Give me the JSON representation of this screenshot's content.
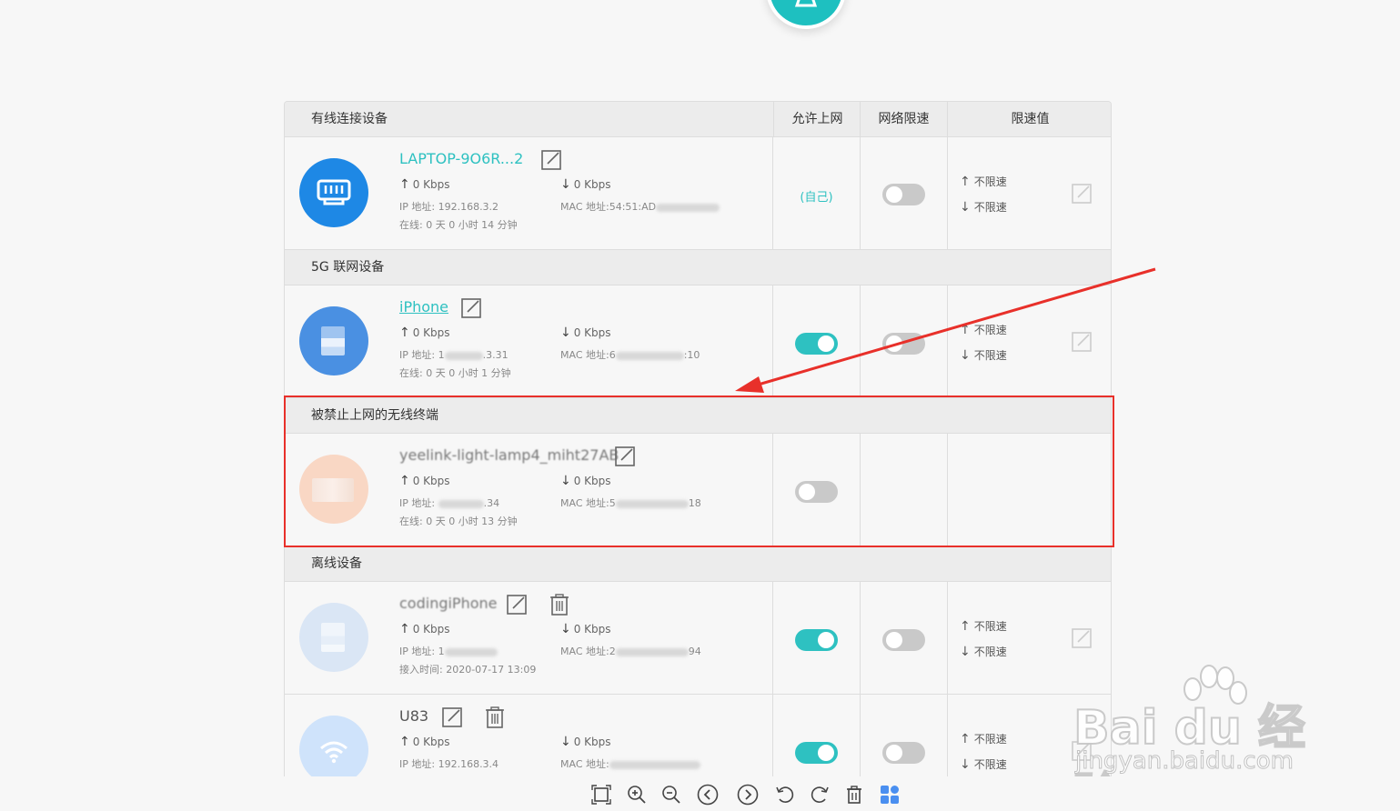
{
  "header": {
    "col_device": "有线连接设备",
    "col_allow": "允许上网",
    "col_speed_limit": "网络限速",
    "col_limit_value": "限速值"
  },
  "sections": {
    "wired": "有线连接设备",
    "g5": "5G 联网设备",
    "blocked": "被禁止上网的无线终端",
    "offline": "离线设备"
  },
  "devices": [
    {
      "name": "LAPTOP-9O6R...2",
      "up": "0 Kbps",
      "down": "0 Kbps",
      "ip": "IP 地址: 192.168.3.2",
      "mac": "MAC 地址:54:51:AD",
      "online": "在线: 0 天 0 小时 14 分钟",
      "allow_text": "(自己)",
      "limit_up": "不限速",
      "limit_down": "不限速"
    },
    {
      "name": "iPhone",
      "up": "0 Kbps",
      "down": "0 Kbps",
      "ip": "IP 地址: 1",
      "ip_tail": ".3.31",
      "mac": "MAC 地址:6",
      "mac_tail": ":10",
      "online": "在线: 0 天 0 小时 1 分钟",
      "limit_up": "不限速",
      "limit_down": "不限速"
    },
    {
      "name": "yeelink-light-lamp4_miht27AB",
      "up": "0 Kbps",
      "down": "0 Kbps",
      "ip": "IP 地址: ",
      "ip_tail": ".34",
      "mac": "MAC 地址:5",
      "mac_tail": "18",
      "online": "在线: 0 天 0 小时 13 分钟"
    },
    {
      "name": "codingiPhone",
      "up": "0 Kbps",
      "down": "0 Kbps",
      "ip": "IP 地址: 1",
      "mac": "MAC 地址:2",
      "mac_tail": "94",
      "online": "接入时间: 2020-07-17 13:09",
      "limit_up": "不限速",
      "limit_down": "不限速"
    },
    {
      "name": "U83",
      "up": "0 Kbps",
      "down": "0 Kbps",
      "ip": "IP 地址: 192.168.3.4",
      "mac": "MAC 地址:",
      "limit_up": "不限速",
      "limit_down": "不限速"
    }
  ],
  "arrows": {
    "up": "↑",
    "down": "↓"
  },
  "watermark": {
    "brand": "Bai du 经验",
    "url": "jingyan.baidu.com"
  },
  "colors": {
    "accent": "#2ec1c1",
    "highlight": "#e8302a",
    "wired_avatar": "#1e88e5"
  }
}
